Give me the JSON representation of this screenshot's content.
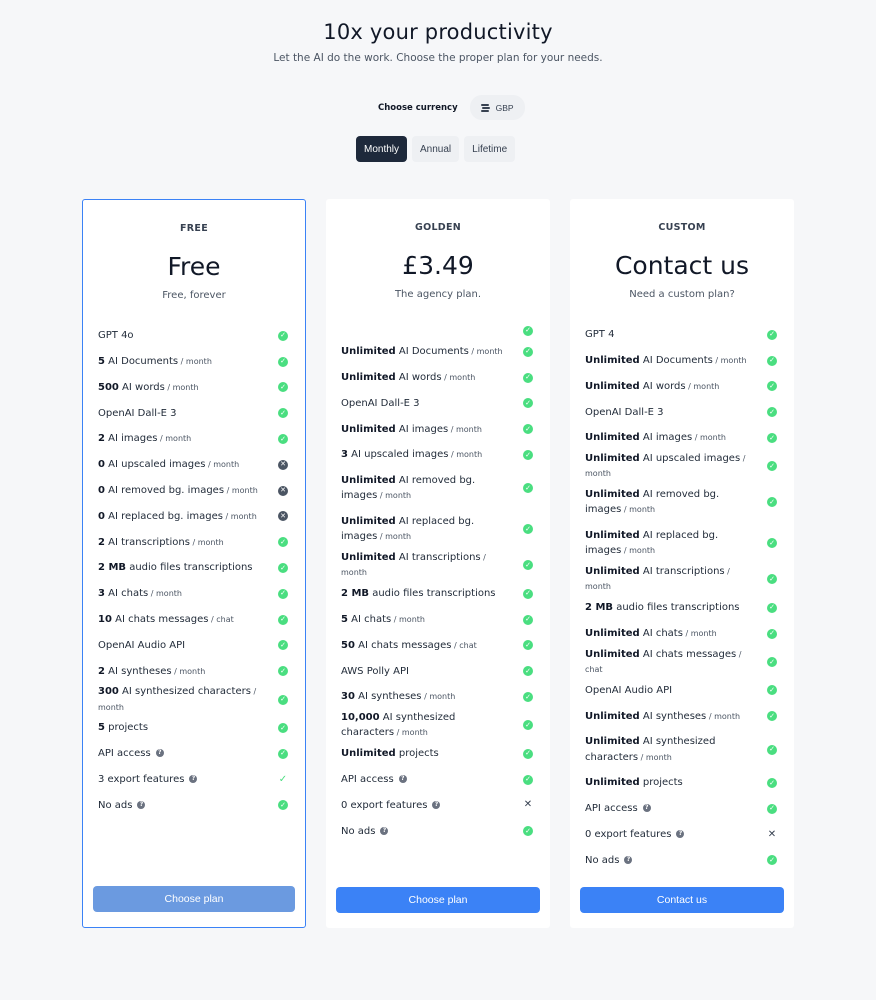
{
  "header": {
    "title": "10x your productivity",
    "subtitle": "Let the AI do the work. Choose the proper plan for your needs."
  },
  "currency": {
    "label": "Choose currency",
    "value": "GBP",
    "icon": "coins-icon"
  },
  "periods": [
    {
      "label": "Monthly",
      "active": true
    },
    {
      "label": "Annual",
      "active": false
    },
    {
      "label": "Lifetime",
      "active": false
    }
  ],
  "colors": {
    "accent": "#3b82f6",
    "check": "#4ade80",
    "dark": "#1e293b"
  },
  "plans": [
    {
      "name": "FREE",
      "price": "Free",
      "description": "Free, forever",
      "cta": "Choose plan",
      "selected": true,
      "features": [
        {
          "bold": "",
          "text": "GPT 4o",
          "unit": "",
          "status": "check"
        },
        {
          "bold": "5",
          "text": " AI Documents",
          "unit": " / month",
          "status": "check"
        },
        {
          "bold": "500",
          "text": " AI words",
          "unit": " / month",
          "status": "check"
        },
        {
          "bold": "",
          "text": "OpenAI Dall-E 3",
          "unit": "",
          "status": "check"
        },
        {
          "bold": "2",
          "text": " AI images",
          "unit": " / month",
          "status": "check"
        },
        {
          "bold": "0",
          "text": " AI upscaled images",
          "unit": " / month",
          "status": "x"
        },
        {
          "bold": "0",
          "text": " AI removed bg. images",
          "unit": " / month",
          "status": "x"
        },
        {
          "bold": "0",
          "text": " AI replaced bg. images",
          "unit": " / month",
          "status": "x"
        },
        {
          "bold": "2",
          "text": " AI transcriptions",
          "unit": " / month",
          "status": "check"
        },
        {
          "bold": "2 MB",
          "text": " audio files transcriptions",
          "unit": "",
          "status": "check"
        },
        {
          "bold": "3",
          "text": " AI chats",
          "unit": " / month",
          "status": "check"
        },
        {
          "bold": "10",
          "text": " AI chats messages",
          "unit": " / chat",
          "status": "check"
        },
        {
          "bold": "",
          "text": "OpenAI Audio API",
          "unit": "",
          "status": "check"
        },
        {
          "bold": "2",
          "text": " AI syntheses",
          "unit": " / month",
          "status": "check"
        },
        {
          "bold": "300",
          "text": " AI synthesized characters",
          "unit": " / month",
          "status": "check"
        },
        {
          "bold": "5",
          "text": " projects",
          "unit": "",
          "status": "check"
        },
        {
          "bold": "",
          "text": "API access",
          "unit": "",
          "status": "check",
          "help": "?"
        },
        {
          "bold": "",
          "text": "3 export features",
          "unit": "",
          "status": "check-plain",
          "help": "?"
        },
        {
          "bold": "",
          "text": "No ads",
          "unit": "",
          "status": "check",
          "help": "?"
        }
      ]
    },
    {
      "name": "GOLDEN",
      "price": "£3.49",
      "description": "The agency plan.",
      "cta": "Choose plan",
      "selected": false,
      "features": [
        {
          "bold": "",
          "text": "",
          "unit": "",
          "status": "check",
          "short": true
        },
        {
          "bold": "Unlimited",
          "text": " AI Documents",
          "unit": " / month",
          "status": "check"
        },
        {
          "bold": "Unlimited",
          "text": " AI words",
          "unit": " / month",
          "status": "check"
        },
        {
          "bold": "",
          "text": "OpenAI Dall-E 3",
          "unit": "",
          "status": "check"
        },
        {
          "bold": "Unlimited",
          "text": " AI images",
          "unit": " / month",
          "status": "check"
        },
        {
          "bold": "3",
          "text": " AI upscaled images",
          "unit": " / month",
          "status": "check"
        },
        {
          "bold": "Unlimited",
          "text": " AI removed bg. images",
          "unit": " / month",
          "status": "check",
          "tall": true
        },
        {
          "bold": "Unlimited",
          "text": " AI replaced bg. images",
          "unit": " / month",
          "status": "check",
          "tall": true
        },
        {
          "bold": "Unlimited",
          "text": " AI transcriptions",
          "unit": " / month",
          "status": "check"
        },
        {
          "bold": "2 MB",
          "text": " audio files transcriptions",
          "unit": "",
          "status": "check"
        },
        {
          "bold": "5",
          "text": " AI chats",
          "unit": " / month",
          "status": "check"
        },
        {
          "bold": "50",
          "text": " AI chats messages",
          "unit": " / chat",
          "status": "check"
        },
        {
          "bold": "",
          "text": "AWS Polly API",
          "unit": "",
          "status": "check"
        },
        {
          "bold": "30",
          "text": " AI syntheses",
          "unit": " / month",
          "status": "check"
        },
        {
          "bold": "10,000",
          "text": " AI synthesized characters",
          "unit": " / month",
          "status": "check"
        },
        {
          "bold": "Unlimited",
          "text": " projects",
          "unit": "",
          "status": "check"
        },
        {
          "bold": "",
          "text": "API access",
          "unit": "",
          "status": "check",
          "help": "?"
        },
        {
          "bold": "",
          "text": "0 export features",
          "unit": "",
          "status": "x-plain",
          "help": "?"
        },
        {
          "bold": "",
          "text": "No ads",
          "unit": "",
          "status": "check",
          "help": "?"
        }
      ]
    },
    {
      "name": "CUSTOM",
      "price": "Contact us",
      "description": "Need a custom plan?",
      "cta": "Contact us",
      "selected": false,
      "features": [
        {
          "bold": "",
          "text": "GPT 4",
          "unit": "",
          "status": "check"
        },
        {
          "bold": "Unlimited",
          "text": " AI Documents",
          "unit": " / month",
          "status": "check"
        },
        {
          "bold": "Unlimited",
          "text": " AI words",
          "unit": " / month",
          "status": "check"
        },
        {
          "bold": "",
          "text": "OpenAI Dall-E 3",
          "unit": "",
          "status": "check"
        },
        {
          "bold": "Unlimited",
          "text": " AI images",
          "unit": " / month",
          "status": "check"
        },
        {
          "bold": "Unlimited",
          "text": " AI upscaled images",
          "unit": " / month",
          "status": "check"
        },
        {
          "bold": "Unlimited",
          "text": " AI removed bg. images",
          "unit": " / month",
          "status": "check",
          "tall": true
        },
        {
          "bold": "Unlimited",
          "text": " AI replaced bg. images",
          "unit": " / month",
          "status": "check",
          "tall": true
        },
        {
          "bold": "Unlimited",
          "text": " AI transcriptions",
          "unit": " / month",
          "status": "check"
        },
        {
          "bold": "2 MB",
          "text": " audio files transcriptions",
          "unit": "",
          "status": "check"
        },
        {
          "bold": "Unlimited",
          "text": " AI chats",
          "unit": " / month",
          "status": "check"
        },
        {
          "bold": "Unlimited",
          "text": " AI chats messages",
          "unit": " / chat",
          "status": "check"
        },
        {
          "bold": "",
          "text": "OpenAI Audio API",
          "unit": "",
          "status": "check"
        },
        {
          "bold": "Unlimited",
          "text": " AI syntheses",
          "unit": " / month",
          "status": "check"
        },
        {
          "bold": "Unlimited",
          "text": " AI synthesized characters",
          "unit": " / month",
          "status": "check",
          "tall": true
        },
        {
          "bold": "Unlimited",
          "text": " projects",
          "unit": "",
          "status": "check"
        },
        {
          "bold": "",
          "text": "API access",
          "unit": "",
          "status": "check",
          "help": "?"
        },
        {
          "bold": "",
          "text": "0 export features",
          "unit": "",
          "status": "x-plain",
          "help": "?"
        },
        {
          "bold": "",
          "text": "No ads",
          "unit": "",
          "status": "check",
          "help": "?"
        }
      ]
    }
  ]
}
